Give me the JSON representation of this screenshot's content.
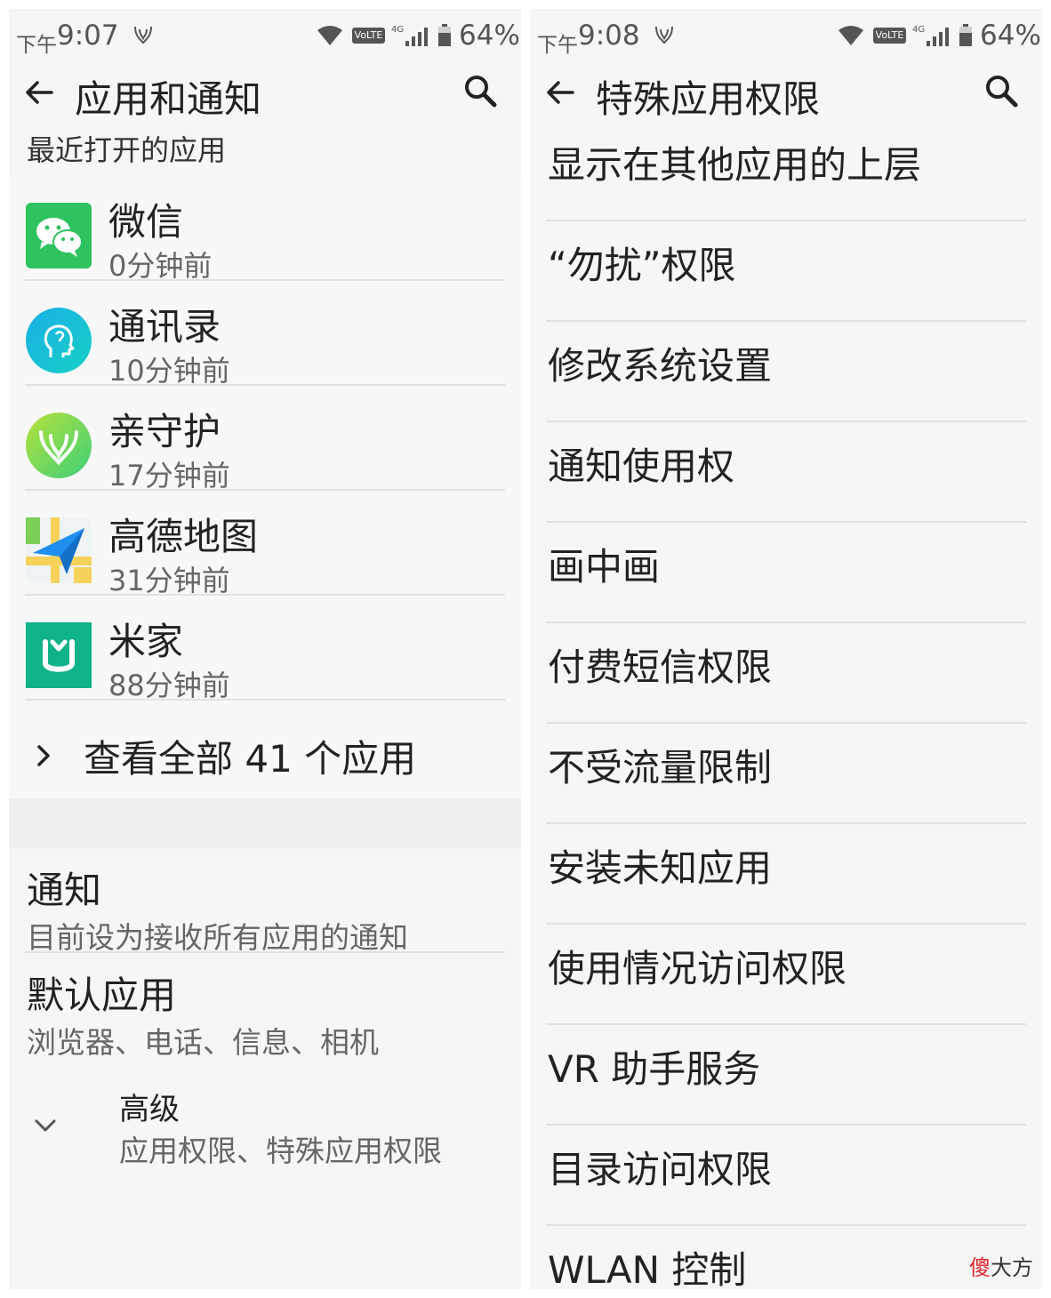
{
  "left": {
    "status": {
      "time_prefix": "下午",
      "time": "9:07",
      "volte": "VoLTE",
      "network": "4G",
      "battery": "64%"
    },
    "appbar": {
      "title": "应用和通知"
    },
    "recent_header": "最近打开的应用",
    "recent_apps": [
      {
        "name": "微信",
        "time": "0分钟前",
        "icon": "wechat-icon"
      },
      {
        "name": "通讯录",
        "time": "10分钟前",
        "icon": "contacts-icon"
      },
      {
        "name": "亲守护",
        "time": "17分钟前",
        "icon": "guardian-icon"
      },
      {
        "name": "高德地图",
        "time": "31分钟前",
        "icon": "amap-icon"
      },
      {
        "name": "米家",
        "time": "88分钟前",
        "icon": "mijia-icon"
      }
    ],
    "see_all": "查看全部 41 个应用",
    "settings": [
      {
        "title": "通知",
        "subtitle": "目前设为接收所有应用的通知"
      },
      {
        "title": "默认应用",
        "subtitle": "浏览器、电话、信息、相机"
      }
    ],
    "advanced": {
      "title": "高级",
      "subtitle": "应用权限、特殊应用权限"
    }
  },
  "right": {
    "status": {
      "time_prefix": "下午",
      "time": "9:08",
      "volte": "VoLTE",
      "network": "4G",
      "battery": "64%"
    },
    "appbar": {
      "title": "特殊应用权限"
    },
    "permissions": [
      "显示在其他应用的上层",
      "“勿扰”权限",
      "修改系统设置",
      "通知使用权",
      "画中画",
      "付费短信权限",
      "不受流量限制",
      "安装未知应用",
      "使用情况访问权限",
      "VR 助手服务",
      "目录访问权限",
      "WLAN 控制"
    ]
  },
  "watermark": {
    "accent": "傻",
    "rest": "大方"
  },
  "colors": {
    "wechat": "#2ec35f",
    "contacts": "#17c2d6",
    "guardian": "#8fd648",
    "mijia": "#10b28a",
    "amap_blue": "#1f8ef1"
  }
}
